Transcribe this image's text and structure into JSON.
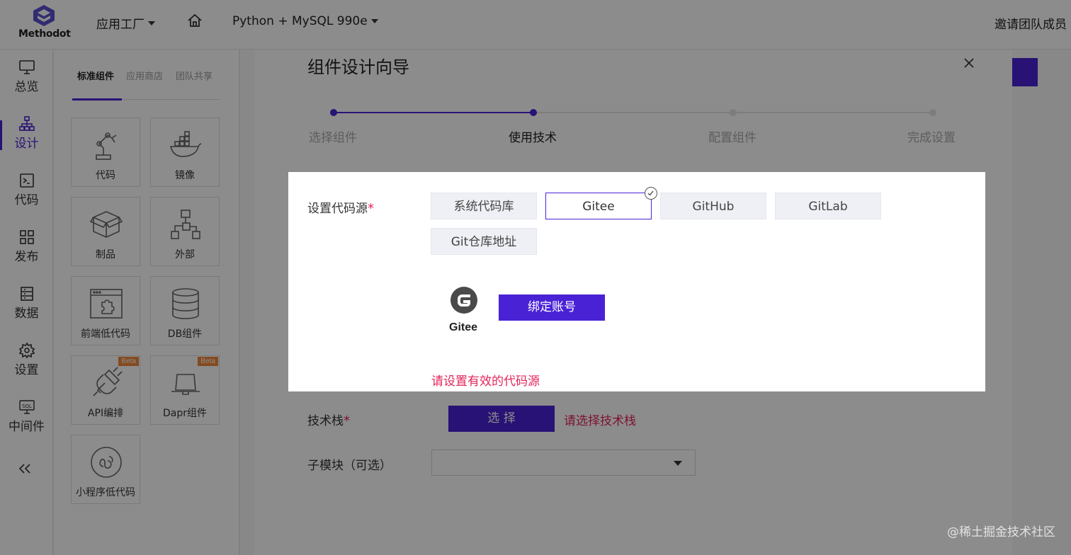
{
  "header": {
    "logo_text": "Methodot",
    "menu_app_factory": "应用工厂",
    "project_name": "Python + MySQL 990e",
    "invite_label": "邀请团队成员"
  },
  "leftnav": {
    "items": [
      {
        "label": "总览",
        "icon": "monitor-icon"
      },
      {
        "label": "设计",
        "icon": "sitemap-icon",
        "active": true
      },
      {
        "label": "代码",
        "icon": "terminal-icon"
      },
      {
        "label": "发布",
        "icon": "grid-icon"
      },
      {
        "label": "数据",
        "icon": "database-list-icon"
      },
      {
        "label": "设置",
        "icon": "gear-icon"
      },
      {
        "label": "中间件",
        "icon": "sql-icon"
      }
    ]
  },
  "palette": {
    "tabs": [
      "标准组件",
      "应用商店",
      "团队共享"
    ],
    "tiles": [
      {
        "label": "代码",
        "icon": "robot-arm-icon"
      },
      {
        "label": "镜像",
        "icon": "docker-whale-icon"
      },
      {
        "label": "制品",
        "icon": "package-box-icon"
      },
      {
        "label": "外部",
        "icon": "network-tree-icon"
      },
      {
        "label": "前端低代码",
        "icon": "browser-puzzle-icon"
      },
      {
        "label": "DB组件",
        "icon": "database-icon"
      },
      {
        "label": "API编排",
        "icon": "plug-icon",
        "badge": "Beta"
      },
      {
        "label": "Dapr组件",
        "icon": "dapr-hat-icon",
        "badge": "Beta"
      },
      {
        "label": "小程序低代码",
        "icon": "mini-program-icon"
      }
    ]
  },
  "wizard": {
    "title": "组件设计向导",
    "steps": [
      "选择组件",
      "使用技术",
      "配置组件",
      "完成设置"
    ],
    "current_step": 2,
    "code_source": {
      "label": "设置代码源",
      "required_mark": "*",
      "options": [
        "系统代码库",
        "Gitee",
        "GitHub",
        "GitLab",
        "Git仓库地址"
      ],
      "selected": "Gitee",
      "provider_name": "Gitee",
      "bind_button": "绑定账号",
      "error": "请设置有效的代码源"
    },
    "tech_stack": {
      "label": "技术栈",
      "required_mark": "*",
      "button": "选 择",
      "error": "请选择技术栈"
    },
    "submodule": {
      "label": "子模块（可选）",
      "value": ""
    }
  },
  "watermark": "@稀土掘金技术社区",
  "colors": {
    "primary": "#4a22d6",
    "error": "#e5245a",
    "beta_badge": "#f0883a"
  }
}
